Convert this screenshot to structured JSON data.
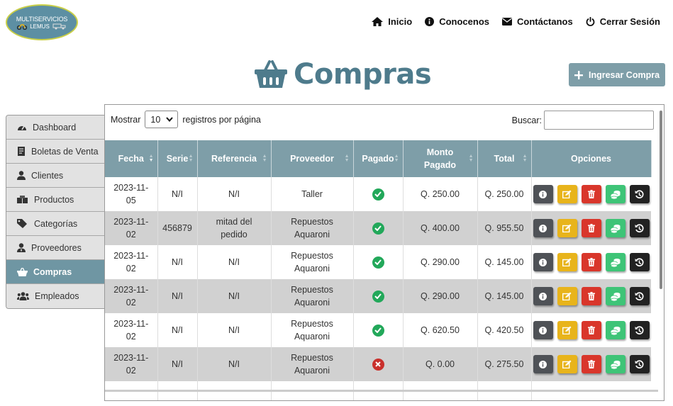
{
  "logo": {
    "line1": "MULTISERVICIOS",
    "line2": "LEMUS"
  },
  "nav": [
    {
      "label": "Inicio",
      "icon": "home-icon"
    },
    {
      "label": "Conocenos",
      "icon": "info-circle-icon"
    },
    {
      "label": "Contáctanos",
      "icon": "envelope-icon"
    },
    {
      "label": "Cerrar Sesión",
      "icon": "power-icon"
    }
  ],
  "page": {
    "title": "Compras",
    "add_button": "Ingresar Compra"
  },
  "sidebar": [
    {
      "label": "Dashboard",
      "icon": "gauge-icon"
    },
    {
      "label": "Boletas de Venta",
      "icon": "receipt-icon"
    },
    {
      "label": "Clientes",
      "icon": "user-icon"
    },
    {
      "label": "Productos",
      "icon": "boxes-icon"
    },
    {
      "label": "Categorías",
      "icon": "tags-icon"
    },
    {
      "label": "Proveedores",
      "icon": "user-tie-icon"
    },
    {
      "label": "Compras",
      "icon": "basket-icon",
      "active": true
    },
    {
      "label": "Empleados",
      "icon": "users-icon"
    }
  ],
  "table_controls": {
    "show_prefix": "Mostrar",
    "page_size": "10",
    "show_suffix": "registros por página",
    "search_label": "Buscar:"
  },
  "columns": [
    "Fecha",
    "Serie",
    "Referencia",
    "Proveedor",
    "Pagado",
    "Monto Pagado",
    "Total",
    "Opciones"
  ],
  "rows": [
    {
      "fecha": "2023-11-05",
      "serie": "N/I",
      "referencia": "N/I",
      "proveedor": "Taller",
      "pagado": true,
      "monto": "Q. 250.00",
      "total": "Q. 250.00"
    },
    {
      "fecha": "2023-11-02",
      "serie": "456879",
      "referencia": "mitad del pedido",
      "proveedor": "Repuestos Aquaroni",
      "pagado": true,
      "monto": "Q. 400.00",
      "total": "Q. 955.50"
    },
    {
      "fecha": "2023-11-02",
      "serie": "N/I",
      "referencia": "N/I",
      "proveedor": "Repuestos Aquaroni",
      "pagado": true,
      "monto": "Q. 290.00",
      "total": "Q. 145.00"
    },
    {
      "fecha": "2023-11-02",
      "serie": "N/I",
      "referencia": "N/I",
      "proveedor": "Repuestos Aquaroni",
      "pagado": true,
      "monto": "Q. 290.00",
      "total": "Q. 145.00"
    },
    {
      "fecha": "2023-11-02",
      "serie": "N/I",
      "referencia": "N/I",
      "proveedor": "Repuestos Aquaroni",
      "pagado": true,
      "monto": "Q. 620.50",
      "total": "Q. 420.50"
    },
    {
      "fecha": "2023-11-02",
      "serie": "N/I",
      "referencia": "N/I",
      "proveedor": "Repuestos Aquaroni",
      "pagado": false,
      "monto": "Q. 0.00",
      "total": "Q. 275.50"
    }
  ],
  "row_actions": [
    "info-icon",
    "edit-icon",
    "trash-icon",
    "coins-icon",
    "history-icon"
  ],
  "colors": {
    "accent": "#4e7b8c",
    "header": "#7e9ea8",
    "active": "#6f96a3",
    "paid": "#22a85a",
    "unpaid": "#c9302c"
  }
}
